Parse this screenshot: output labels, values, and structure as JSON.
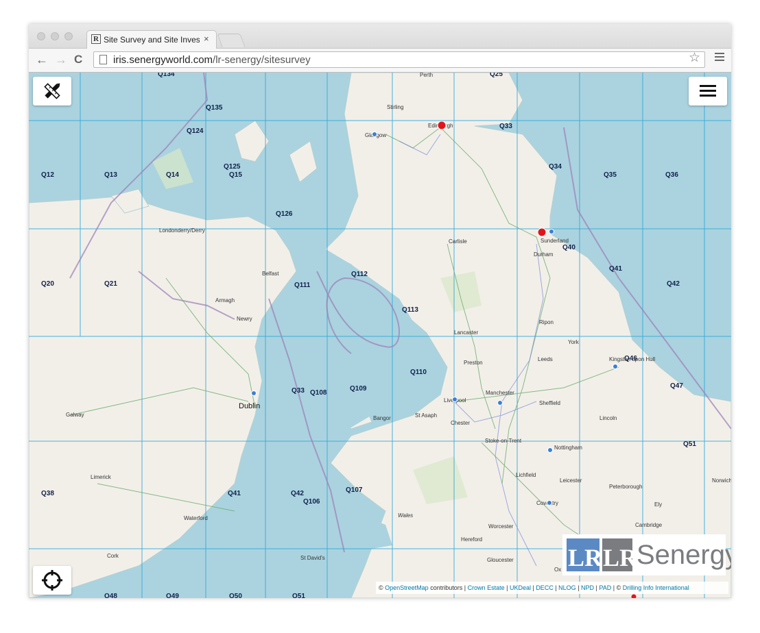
{
  "browser": {
    "tab_title": "Site Survey and Site Invest",
    "tab_close": "×",
    "favicon_text": "R",
    "url_host": "iris.senergyworld.com",
    "url_path": "/lr-senergy/sitesurvey",
    "back_icon": "←",
    "forward_icon": "→",
    "reload_icon": "C",
    "bookmark_icon": "☆"
  },
  "map": {
    "quadrants": [
      "Q134",
      "Q25",
      "Q135",
      "Q124",
      "Q33",
      "Q125",
      "Q15",
      "Q34",
      "Q12",
      "Q13",
      "Q14",
      "Q35",
      "Q36",
      "Q126",
      "Q40",
      "Q41",
      "Q20",
      "Q21",
      "Q111",
      "Q112",
      "Q42",
      "Q113",
      "Q46",
      "Q110",
      "Q33",
      "Q108",
      "Q109",
      "Q47",
      "Q51",
      "Q38",
      "Q41",
      "Q42",
      "Q106",
      "Q107",
      "Q48",
      "Q49",
      "Q50",
      "Q51"
    ],
    "places": [
      "Perth",
      "Stirling",
      "Edinburgh",
      "Glasgow",
      "Londonderry/Derry",
      "Carlisle",
      "Sunderland",
      "Durham",
      "Belfast",
      "Armagh",
      "Newry",
      "Ripon",
      "York",
      "Lancaster",
      "Preston",
      "Leeds",
      "Kingston upon Hull",
      "Dublin",
      "Liverpool",
      "Manchester",
      "Sheffield",
      "Galway",
      "Bangor",
      "St Asaph",
      "Chester",
      "Lincoln",
      "Stoke-on-Trent",
      "Nottingham",
      "Limerick",
      "Lichfield",
      "Leicester",
      "Peterborough",
      "Norwich",
      "Coventry",
      "Ely",
      "Waterford",
      "Wales",
      "Worcester",
      "Cambridge",
      "Hereford",
      "Cork",
      "St David's",
      "Gloucester",
      "Ox"
    ]
  },
  "controls": {
    "tools_icon": "✎",
    "locate_icon": "⌖"
  },
  "logo": {
    "mark_left": "LR",
    "mark_right": "LR",
    "brand": "Senergy"
  },
  "attribution": {
    "copyright": "©",
    "osm": "OpenStreetMap",
    "contributors": " contributors | ",
    "crown": "Crown Estate",
    "sep1": " | ",
    "ukdeal": "UKDeal",
    "sep2": " | ",
    "decc": "DECC",
    "sep3": " | ",
    "nlog": "NLOG",
    "sep4": " | ",
    "npd": "NPD",
    "sep5": " | ",
    "pad": "PAD",
    "sep6": " | © ",
    "drilling": "Drilling Info International"
  },
  "colors": {
    "sea": "#aad3df",
    "land": "#f2efe9",
    "grid": "#2aa6d8",
    "marker_red": "#e0161b",
    "marker_blue": "#3a7fd5"
  }
}
